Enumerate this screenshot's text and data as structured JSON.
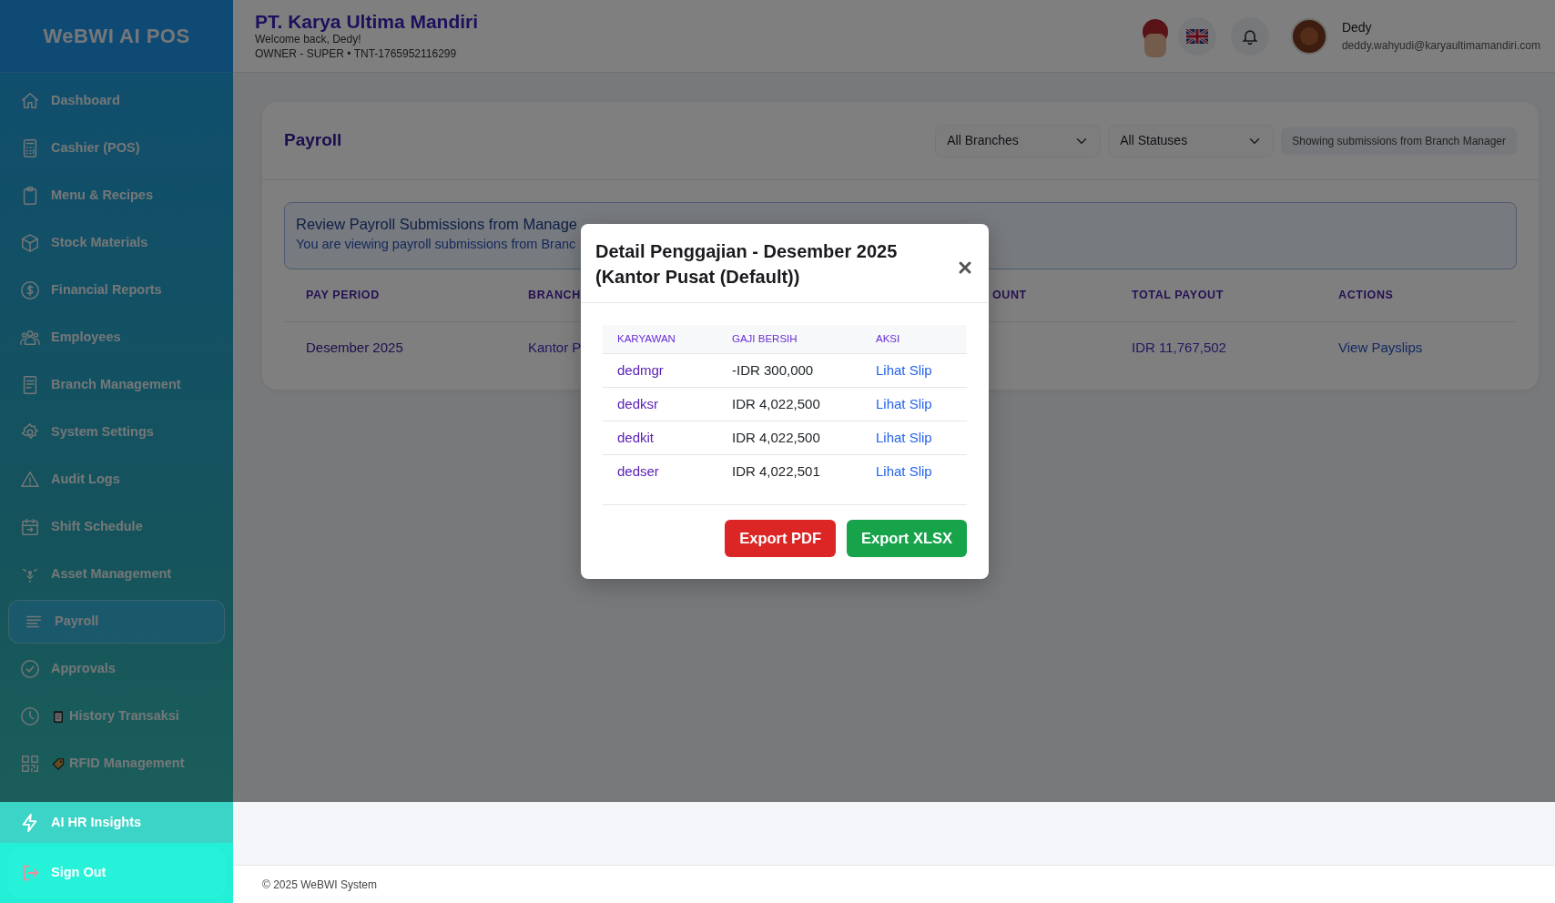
{
  "sidebar": {
    "brand": "WeBWI AI POS",
    "items": [
      {
        "label": "Dashboard",
        "selected": false
      },
      {
        "label": "Cashier (POS)",
        "selected": false
      },
      {
        "label": "Menu & Recipes",
        "selected": false
      },
      {
        "label": "Stock Materials",
        "selected": false
      },
      {
        "label": "Financial Reports",
        "selected": false
      },
      {
        "label": "Employees",
        "selected": false
      },
      {
        "label": "Branch Management",
        "selected": false
      },
      {
        "label": "System Settings",
        "selected": false
      },
      {
        "label": "Audit Logs",
        "selected": false
      },
      {
        "label": "Shift Schedule",
        "selected": false
      },
      {
        "label": "Asset Management",
        "selected": false
      },
      {
        "label": "Payroll",
        "selected": true
      },
      {
        "label": "Approvals",
        "selected": false
      },
      {
        "label": "History Transaksi",
        "selected": false
      },
      {
        "label": "RFID Management",
        "selected": false
      }
    ],
    "insights": "AI HR Insights",
    "sign_out": "Sign Out"
  },
  "header": {
    "company": "PT. Karya Ultima Mandiri",
    "welcome": "Welcome back, Dedy!",
    "role_line": "OWNER - SUPER • TNT-1765952116299",
    "user": {
      "name": "Dedy",
      "email": "deddy.wahyudi@karyaultimamandiri.com"
    }
  },
  "payroll": {
    "title": "Payroll",
    "filters": [
      "All Branches",
      "All Statuses"
    ],
    "note": "Showing submissions from Branch Manager",
    "alert": {
      "title": "Review Payroll Submissions from Manage",
      "text": "You are viewing payroll submissions from Branc"
    },
    "table": {
      "columns": [
        "PAY PERIOD",
        "BRANCH",
        "OUNT",
        "TOTAL PAYOUT",
        "ACTIONS"
      ],
      "rows": [
        {
          "pay_period": "Desember 2025",
          "branch": "Kantor P",
          "total_payout": "IDR 11,767,502",
          "action": "View Payslips"
        }
      ]
    }
  },
  "modal": {
    "title": "Detail Penggajian - Desember 2025 (Kantor Pusat (Default))",
    "columns": [
      "KARYAWAN",
      "GAJI BERSIH",
      "AKSI"
    ],
    "rows": [
      {
        "employee": "dedmgr",
        "net_salary": "-IDR 300,000",
        "action": "Lihat Slip"
      },
      {
        "employee": "dedksr",
        "net_salary": "IDR 4,022,500",
        "action": "Lihat Slip"
      },
      {
        "employee": "dedkit",
        "net_salary": "IDR 4,022,500",
        "action": "Lihat Slip"
      },
      {
        "employee": "dedser",
        "net_salary": "IDR 4,022,501",
        "action": "Lihat Slip"
      }
    ],
    "buttons": [
      {
        "label": "Export PDF",
        "kind": "danger"
      },
      {
        "label": "Export XLSX",
        "kind": "success"
      }
    ]
  },
  "footer": "© 2025 WeBWI System"
}
